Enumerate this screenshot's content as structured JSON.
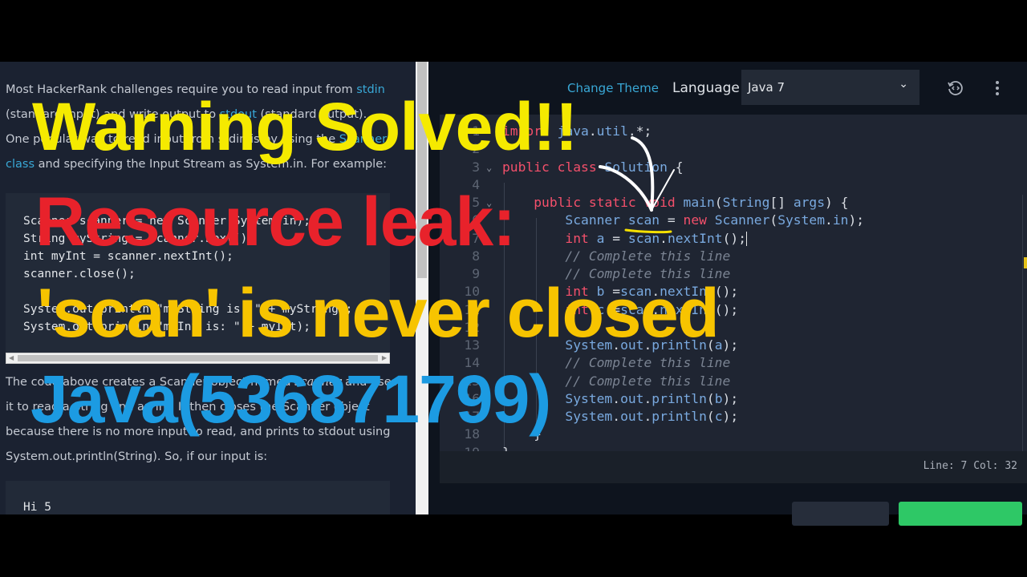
{
  "problem": {
    "p1": {
      "t1": "Most HackerRank challenges require you to read input from ",
      "link1": "stdin",
      "t2": " (standard input) and write output to ",
      "link2": "stdout",
      "t3": " (standard output)."
    },
    "p2": {
      "t1": "One popular way to read input from stdin is by using the ",
      "link1": "Scanner class",
      "t2": " and specifying the Input Stream as System.in. For example:"
    },
    "example_code": [
      "Scanner scanner = new Scanner(System.in);",
      "String myString = scanner.next();",
      "int myInt = scanner.nextInt();",
      "scanner.close();",
      "",
      "System.out.println(\"myString is: \" + myString);",
      "System.out.println(\"myInt is: \" + myInt);"
    ],
    "p3": {
      "t1": "The code above creates a Scanner object named ",
      "em": "scanner",
      "t2": " and uses it to read a String and an int. It then closes the Scanner object because there is no more input to read, and prints to stdout using System.out.println(String). So, if our input is:"
    },
    "input_code": [
      "Hi 5"
    ]
  },
  "toolbar": {
    "change_theme": "Change Theme",
    "language_label": "Language",
    "language_value": "Java 7",
    "icons": [
      "reset-code-icon",
      "more-vertical-icon",
      "chevron-down-icon"
    ]
  },
  "editor": {
    "lines": [
      {
        "n": "1",
        "code": "import java.util.*;"
      },
      {
        "n": "2",
        "code": ""
      },
      {
        "n": "3",
        "code": "public class Solution {",
        "fold": true
      },
      {
        "n": "4",
        "code": ""
      },
      {
        "n": "5",
        "code": "    public static void main(String[] args) {",
        "fold": true
      },
      {
        "n": "6",
        "code": "        Scanner scan = new Scanner(System.in);"
      },
      {
        "n": "7",
        "code": "        int a = scan.nextInt();"
      },
      {
        "n": "8",
        "code": "        // Complete this line"
      },
      {
        "n": "9",
        "code": "        // Complete this line"
      },
      {
        "n": "10",
        "code": "        int b =scan.nextInt();"
      },
      {
        "n": "11",
        "code": "        int c =scan.nextInt();"
      },
      {
        "n": "12",
        "code": ""
      },
      {
        "n": "13",
        "code": "        System.out.println(a);"
      },
      {
        "n": "14",
        "code": "        // Complete this line"
      },
      {
        "n": "15",
        "code": "        // Complete this line"
      },
      {
        "n": "16",
        "code": "        System.out.println(b);"
      },
      {
        "n": "17",
        "code": "        System.out.println(c);"
      },
      {
        "n": "18",
        "code": "    }"
      },
      {
        "n": "19",
        "code": "}"
      }
    ],
    "status": "Line: 7 Col: 32"
  },
  "overlay": {
    "line1": "Warning Solved!!",
    "line2": "Resource leak:",
    "line3": "'scan' is never closed",
    "line4": "Java(536871799)",
    "colors": {
      "line1": "#f5ea00",
      "line2": "#e8222b",
      "line3": "#f7c400",
      "line4": "#1c9be2"
    }
  },
  "colors": {
    "link": "#39a8d6",
    "keyword": "#f4506b",
    "submit": "#2ec866"
  }
}
